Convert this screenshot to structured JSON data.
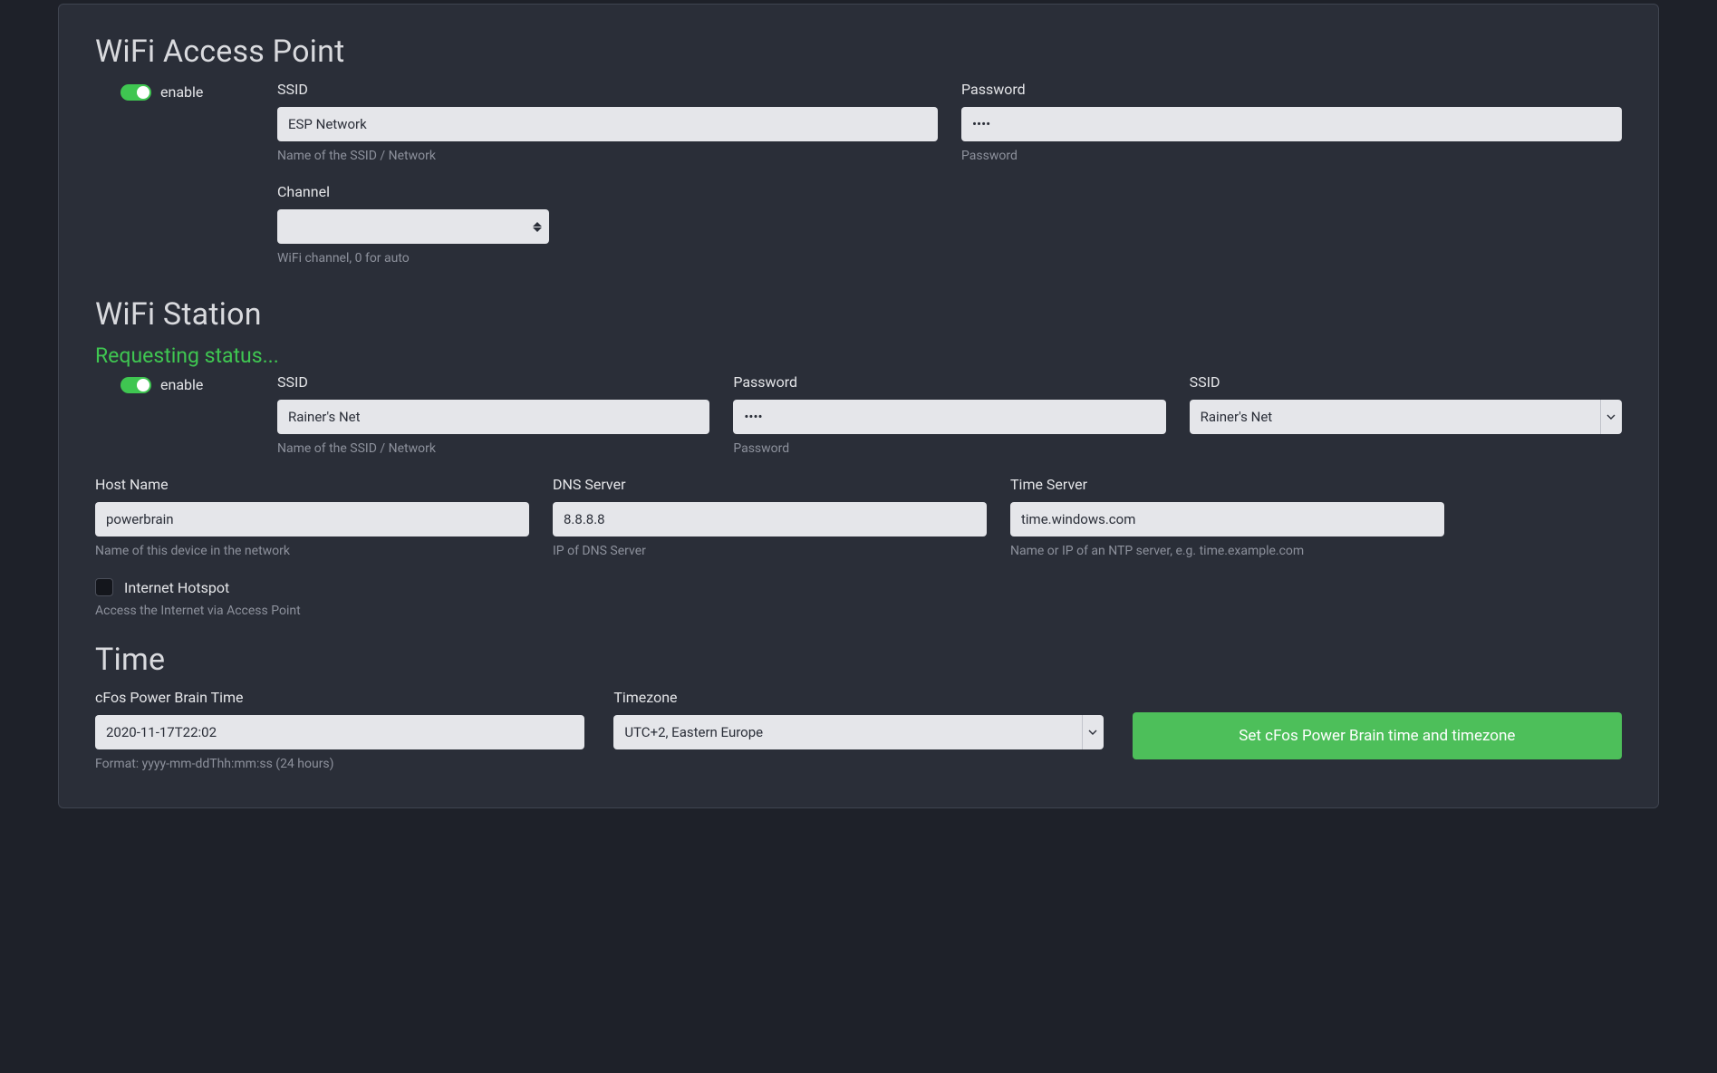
{
  "ap": {
    "title": "WiFi Access Point",
    "enable_label": "enable",
    "ssid_label": "SSID",
    "ssid_value": "ESP Network",
    "ssid_help": "Name of the SSID / Network",
    "password_label": "Password",
    "password_value": "••••",
    "password_help": "Password",
    "channel_label": "Channel",
    "channel_value": "",
    "channel_help": "WiFi channel, 0 for auto"
  },
  "station": {
    "title": "WiFi Station",
    "status": "Requesting status...",
    "enable_label": "enable",
    "ssid_label": "SSID",
    "ssid_value": "Rainer's Net",
    "ssid_help": "Name of the SSID / Network",
    "password_label": "Password",
    "password_value": "••••",
    "password_help": "Password",
    "ssid_select_label": "SSID",
    "ssid_select_value": "Rainer's Net",
    "host_label": "Host Name",
    "host_value": "powerbrain",
    "host_help": "Name of this device in the network",
    "dns_label": "DNS Server",
    "dns_value": "8.8.8.8",
    "dns_help": "IP of DNS Server",
    "time_server_label": "Time Server",
    "time_server_value": "time.windows.com",
    "time_server_help": "Name or IP of an NTP server, e.g. time.example.com",
    "hotspot_label": "Internet Hotspot",
    "hotspot_help": "Access the Internet via Access Point"
  },
  "time": {
    "title": "Time",
    "clock_label": "cFos Power Brain Time",
    "clock_value": "2020-11-17T22:02",
    "clock_help": "Format: yyyy-mm-ddThh:mm:ss (24 hours)",
    "tz_label": "Timezone",
    "tz_value": "UTC+2, Eastern Europe",
    "button_label": "Set cFos Power Brain time and timezone"
  }
}
